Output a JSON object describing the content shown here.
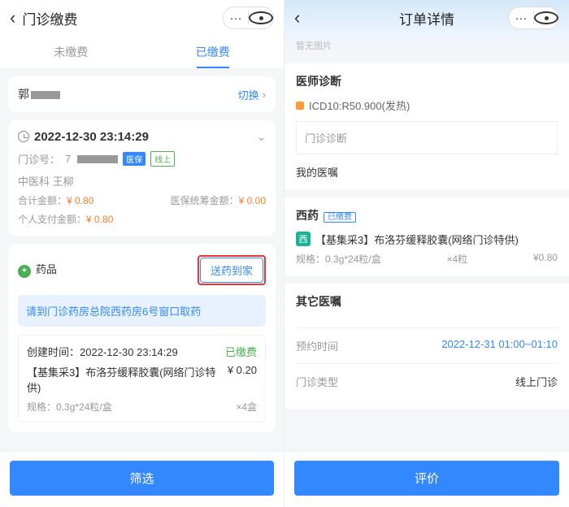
{
  "left": {
    "header": {
      "title": "门诊缴费"
    },
    "tabs": {
      "unpaid": "未缴费",
      "paid": "已缴费"
    },
    "user": {
      "name_prefix": "郭",
      "switch": "切换"
    },
    "record": {
      "datetime": "2022-12-30 23:14:29",
      "visit_no_label": "门诊号：",
      "visit_no_prefix": "7",
      "badge_insurance": "医保",
      "badge_online": "线上",
      "dept_doctor": "中医科 王柳",
      "total_label": "合计金额：",
      "total_value": "¥ 0.80",
      "pooled_label": "医保统筹金额：",
      "pooled_value": "¥ 0.00",
      "self_label": "个人支付金额：",
      "self_value": "¥ 0.80"
    },
    "meds": {
      "title": "药品",
      "deliver_btn": "送药到家",
      "notice": "请到门诊药房总院西药房6号窗口取药",
      "create_label": "创建时间：",
      "create_time": "2022-12-30 23:14:29",
      "status": "已缴费",
      "item_name": "【基集采3】布洛芬缓释胶囊(网络门诊特供)",
      "item_price": "¥ 0.20",
      "spec_label": "规格：",
      "spec_value": "0.3g*24粒/盒",
      "qty": "×4盒"
    },
    "footer_btn": "筛选"
  },
  "right": {
    "header": {
      "title": "订单详情"
    },
    "top_hint": "暂无图片",
    "diag": {
      "title": "医师诊断",
      "icd": "ICD10:R50.900(发热)",
      "sub": "门诊诊断",
      "my": "我的医嘱"
    },
    "western": {
      "title": "西药",
      "tag": "已缴费",
      "icon": "西",
      "name": "【基集采3】布洛芬缓释胶囊(网络门诊特供)",
      "spec_label": "规格：",
      "spec_value": "0.3g*24粒/盒",
      "qty": "×4粒",
      "price": "¥0.80"
    },
    "other": {
      "title": "其它医嘱"
    },
    "appt": {
      "label": "预约时间",
      "value": "2022-12-31 01:00~01:10",
      "type_label": "门诊类型",
      "type_value": "线上门诊"
    },
    "footer_btn": "评价"
  }
}
